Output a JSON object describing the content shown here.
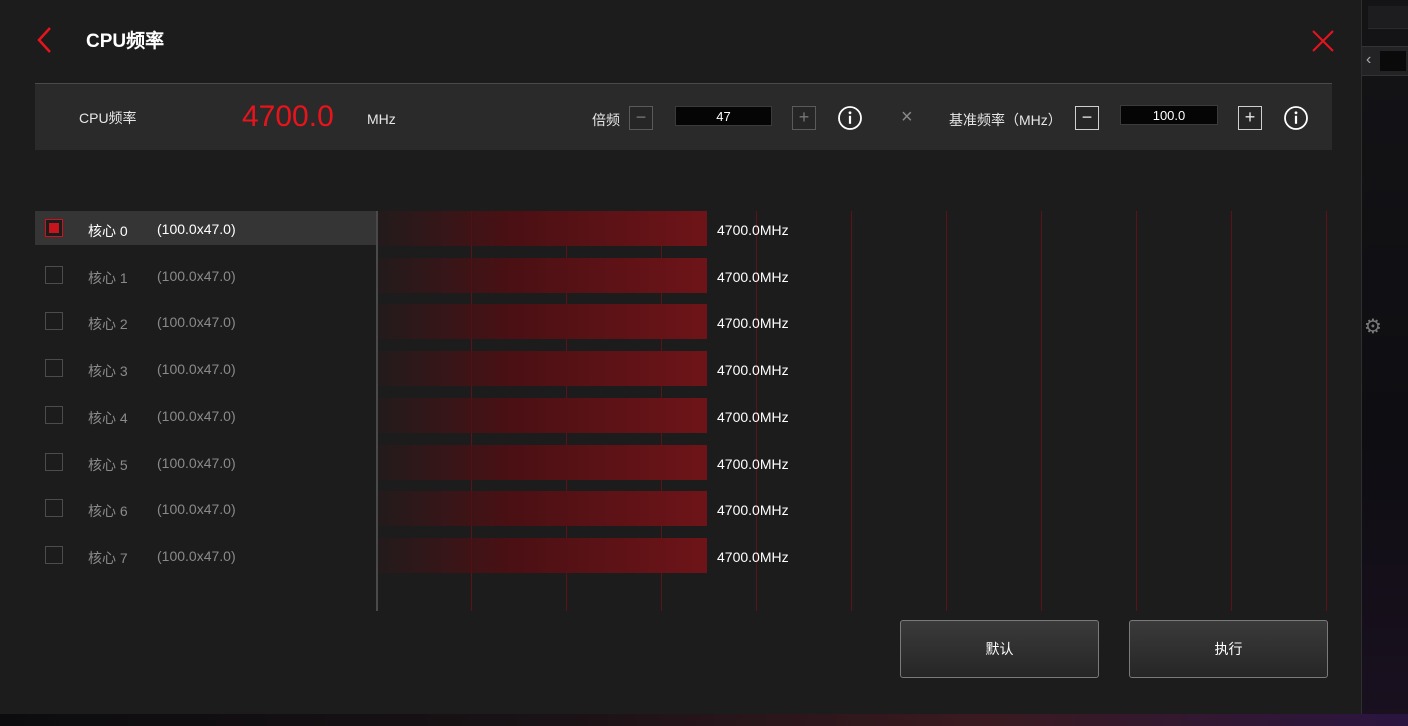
{
  "header": {
    "title": "CPU频率"
  },
  "controls": {
    "cpu_label": "CPU频率",
    "cpu_freq_value": "4700.0",
    "cpu_freq_unit": "MHz",
    "multiplier_label": "倍频",
    "multiplier_value": "47",
    "times_symbol": "×",
    "base_label": "基准频率（MHz）",
    "base_value": "100.0"
  },
  "cores": [
    {
      "name": "核心 0",
      "ratio": "(100.0x47.0)",
      "freq": "4700.0MHz",
      "checked": true
    },
    {
      "name": "核心 1",
      "ratio": "(100.0x47.0)",
      "freq": "4700.0MHz",
      "checked": false
    },
    {
      "name": "核心 2",
      "ratio": "(100.0x47.0)",
      "freq": "4700.0MHz",
      "checked": false
    },
    {
      "name": "核心 3",
      "ratio": "(100.0x47.0)",
      "freq": "4700.0MHz",
      "checked": false
    },
    {
      "name": "核心 4",
      "ratio": "(100.0x47.0)",
      "freq": "4700.0MHz",
      "checked": false
    },
    {
      "name": "核心 5",
      "ratio": "(100.0x47.0)",
      "freq": "4700.0MHz",
      "checked": false
    },
    {
      "name": "核心 6",
      "ratio": "(100.0x47.0)",
      "freq": "4700.0MHz",
      "checked": false
    },
    {
      "name": "核心 7",
      "ratio": "(100.0x47.0)",
      "freq": "4700.0MHz",
      "checked": false
    }
  ],
  "chart_data": {
    "type": "bar",
    "categories": [
      "核心 0",
      "核心 1",
      "核心 2",
      "核心 3",
      "核心 4",
      "核心 5",
      "核心 6",
      "核心 7"
    ],
    "values": [
      4700,
      4700,
      4700,
      4700,
      4700,
      4700,
      4700,
      4700
    ],
    "xlim": [
      0,
      10000
    ],
    "grid": true
  },
  "buttons": {
    "default_label": "默认",
    "apply_label": "执行"
  },
  "colors": {
    "accent": "#e8141c",
    "bar": "#6e1418",
    "grid": "#5a1418"
  },
  "icons": {
    "back": "chevron-left-icon",
    "close": "close-icon",
    "minus": "minus-icon",
    "plus": "plus-icon",
    "info": "info-icon",
    "gear": "gear-icon"
  }
}
